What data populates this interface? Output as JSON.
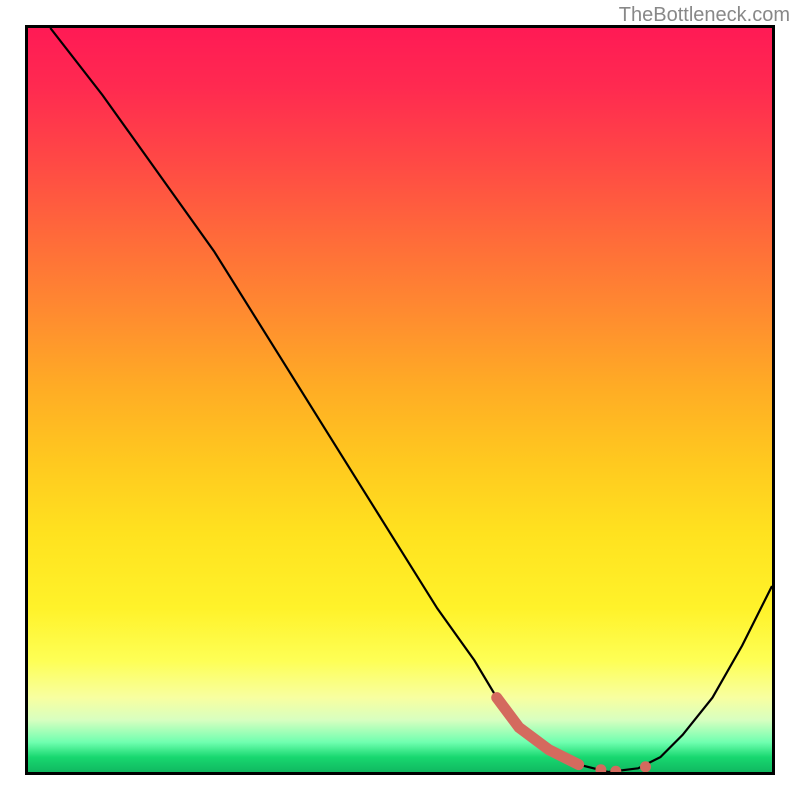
{
  "watermark": "TheBottleneck.com",
  "chart_data": {
    "type": "line",
    "title": "",
    "xlabel": "",
    "ylabel": "",
    "xlim": [
      0,
      100
    ],
    "ylim": [
      0,
      100
    ],
    "series": [
      {
        "name": "bottleneck-curve",
        "x": [
          3,
          10,
          20,
          25,
          30,
          35,
          40,
          45,
          50,
          55,
          60,
          63,
          66,
          70,
          74,
          78,
          82,
          85,
          88,
          92,
          96,
          100
        ],
        "values": [
          100,
          91,
          77,
          70,
          62,
          54,
          46,
          38,
          30,
          22,
          15,
          10,
          6,
          3,
          1,
          0,
          0.5,
          2,
          5,
          10,
          17,
          25
        ]
      }
    ],
    "highlight_segment": {
      "name": "minimum-region",
      "x": [
        63,
        66,
        70,
        74
      ],
      "values": [
        10,
        6,
        3,
        1
      ]
    },
    "highlight_points": [
      {
        "x": 77,
        "y": 0.3
      },
      {
        "x": 79,
        "y": 0.1
      },
      {
        "x": 83,
        "y": 0.7
      }
    ],
    "colors": {
      "curve": "#000000",
      "highlight": "#d46a5e",
      "gradient_top": "#ff1a55",
      "gradient_bottom": "#10b860"
    }
  }
}
